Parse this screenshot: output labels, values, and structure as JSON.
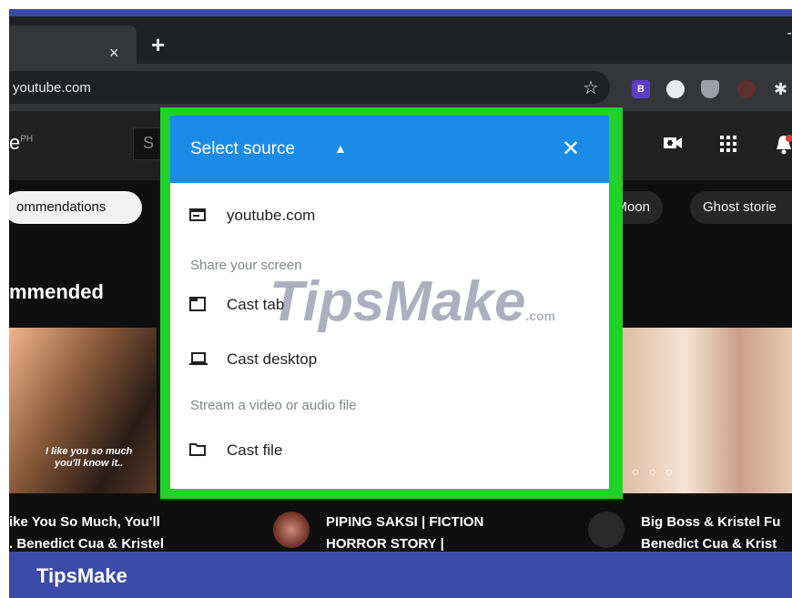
{
  "browser": {
    "tab_close": "×",
    "new_tab": "+",
    "window_control": "-",
    "url": "youtube.com",
    "bookmark_icon": "star-icon",
    "extension_badge": "B"
  },
  "youtube": {
    "logo_text": "e",
    "logo_region": "PH",
    "search_partial": "S",
    "chips": [
      "ommendations",
      "Moon",
      "Ghost storie"
    ],
    "section_title": "mmended",
    "thumbnail_caption": "I like you so much\nyou'll know it..",
    "videos": [
      {
        "title_line1": "ike You So Much, You'll",
        "title_line2": ". Benedict Cua & Kristel"
      },
      {
        "title_line1": "PIPING SAKSI | FICTION",
        "title_line2": "HORROR STORY |"
      },
      {
        "title_line1": "Big Boss & Kristel Fu",
        "title_line2": "Benedict Cua & Krist"
      }
    ]
  },
  "cast_dialog": {
    "title": "Select source",
    "close": "✕",
    "caret": "▲",
    "current_tab_source": "youtube.com",
    "share_screen_label": "Share your screen",
    "cast_tab_label": "Cast tab",
    "cast_desktop_label": "Cast desktop",
    "stream_label": "Stream a video or audio file",
    "cast_file_label": "Cast file",
    "highlight_color": "#22d02a",
    "header_color": "#1a8ce8"
  },
  "watermark": {
    "text": "TipsMake",
    "suffix": ".com"
  },
  "footer": {
    "brand": "TipsMake"
  }
}
